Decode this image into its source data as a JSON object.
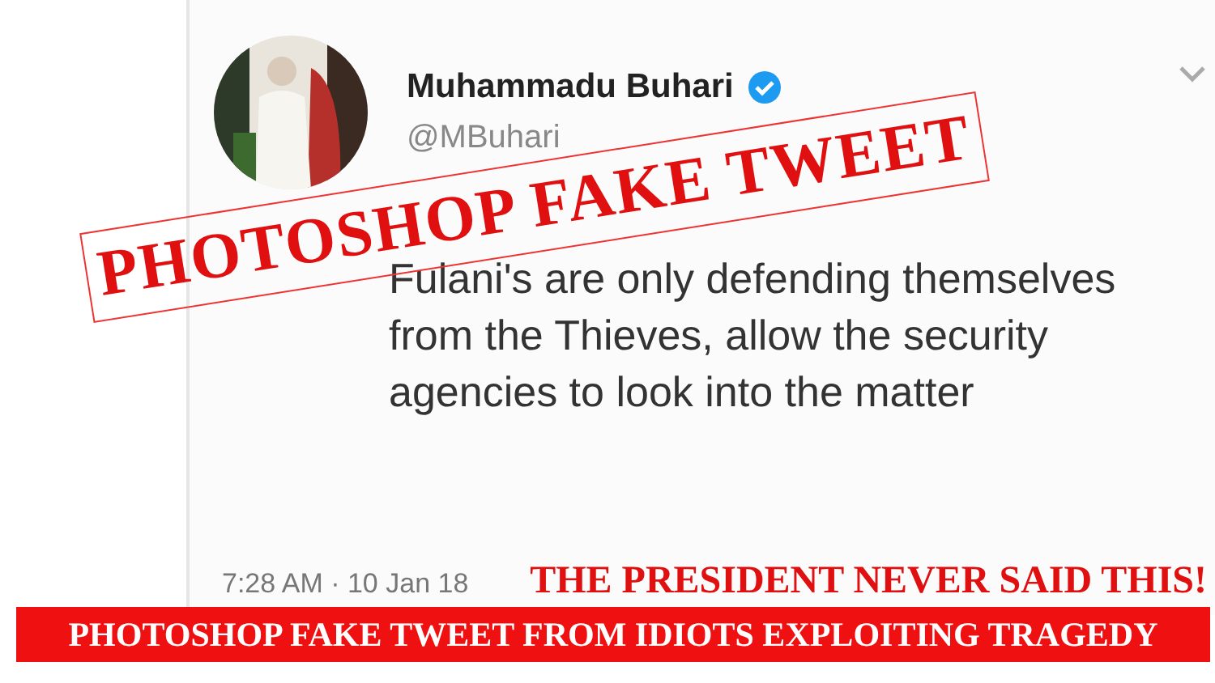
{
  "tweet": {
    "author": "Muhammadu Buhari",
    "verified": true,
    "handle": "@MBuhari",
    "text": "Fulani's are only defending themselves from the Thieves, allow the security agencies to look into the matter",
    "time": "7:28 AM · 10 Jan 18"
  },
  "stamp": {
    "text": "PHOTOSHOP FAKE TWEET"
  },
  "note": {
    "text": "THE PRESIDENT NEVER SAID THIS!"
  },
  "banner": {
    "text": "PHOTOSHOP FAKE TWEET FROM IDIOTS EXPLOITING TRAGEDY"
  }
}
